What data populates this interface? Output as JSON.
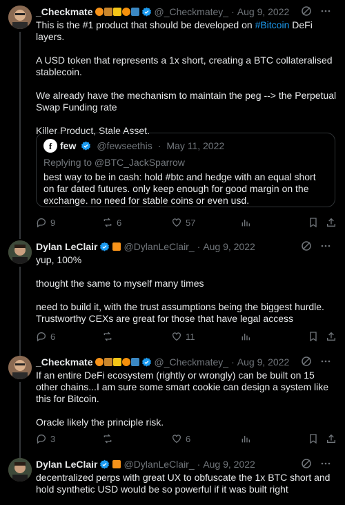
{
  "tweets": [
    {
      "name": "_Checkmate",
      "handle": "@_Checkmatey_",
      "date": "Aug 9, 2022",
      "paragraphs": [
        "This is the #1 product that should be developed on ",
        "A USD token that represents a 1x short, creating a BTC collateralised stablecoin.",
        "We already have the mechanism to maintain the peg --> the Perpetual Swap Funding rate",
        "Killer Product, Stale Asset."
      ],
      "hashtag": "#Bitcoin",
      "after_hashtag": " DeFi layers.",
      "quote": {
        "avatar_letter": "f",
        "name": "few",
        "handle": "@fewseethis",
        "date": "May 11, 2022",
        "replying": "Replying to @BTC_JackSparrow",
        "text": "best way to be in cash: hold #btc and hedge with an equal short on far dated futures. only keep enough for good margin on the exchange. no need for stable coins or even usd."
      },
      "replies": "9",
      "retweets": "6",
      "likes": "57",
      "views": ""
    },
    {
      "name": "Dylan LeClair",
      "handle": "@DylanLeClair_",
      "date": "Aug 9, 2022",
      "paragraphs": [
        "yup, 100%",
        "thought the same to myself many times",
        "need to build it, with the trust assumptions being the biggest hurdle. Trustworthy CEXs are great for those that have legal access"
      ],
      "replies": "6",
      "retweets": "",
      "likes": "11",
      "views": ""
    },
    {
      "name": "_Checkmate",
      "handle": "@_Checkmatey_",
      "date": "Aug 9, 2022",
      "paragraphs": [
        "If an entire DeFi ecosystem (rightly or wrongly) can be built on 15 other chains...I am sure some smart cookie can design a system like this for Bitcoin.",
        "Oracle likely the principle risk."
      ],
      "replies": "3",
      "retweets": "",
      "likes": "6",
      "views": ""
    },
    {
      "name": "Dylan LeClair",
      "handle": "@DylanLeClair_",
      "date": "Aug 9, 2022",
      "paragraphs": [
        "decentralized perps with great UX to obfuscate the 1x BTC short and hold synthetic USD would be so powerful if it was built right"
      ]
    }
  ],
  "colors": {
    "background": "#000000",
    "text": "#e7e9ea",
    "muted": "#71767b",
    "accent": "#1d9bf0",
    "border": "#2f3336"
  },
  "icons": [
    "reply-icon",
    "retweet-icon",
    "like-icon",
    "views-icon",
    "bookmark-icon",
    "share-icon",
    "verified-icon",
    "grok-icon",
    "more-icon"
  ]
}
